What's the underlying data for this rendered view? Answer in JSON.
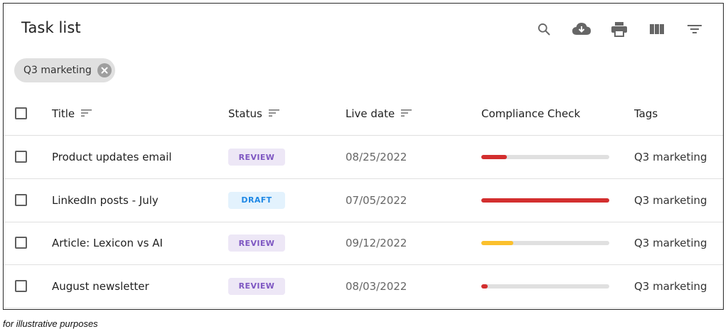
{
  "header": {
    "title": "Task list",
    "toolbar": [
      {
        "name": "search-icon"
      },
      {
        "name": "download-icon"
      },
      {
        "name": "print-icon"
      },
      {
        "name": "view-columns-icon"
      },
      {
        "name": "filter-icon"
      }
    ]
  },
  "filter_chip": {
    "label": "Q3 marketing",
    "icon": "close-circle-icon"
  },
  "table": {
    "columns": {
      "title": "Title",
      "status": "Status",
      "live_date": "Live date",
      "compliance": "Compliance Check",
      "tags": "Tags"
    },
    "rows": [
      {
        "title": "Product updates email",
        "status": "REVIEW",
        "live_date": "08/25/2022",
        "compliance": 0.2,
        "compliance_color": "#d32f2f",
        "tags": "Q3 marketing"
      },
      {
        "title": "LinkedIn posts - July",
        "status": "DRAFT",
        "live_date": "07/05/2022",
        "compliance": 1.0,
        "compliance_color": "#d32f2f",
        "tags": "Q3 marketing"
      },
      {
        "title": "Article: Lexicon vs AI",
        "status": "REVIEW",
        "live_date": "09/12/2022",
        "compliance": 0.25,
        "compliance_color": "#fbc02d",
        "tags": "Q3 marketing"
      },
      {
        "title": "August newsletter",
        "status": "REVIEW",
        "live_date": "08/03/2022",
        "compliance": 0.05,
        "compliance_color": "#d32f2f",
        "tags": "Q3 marketing"
      }
    ]
  },
  "colors": {
    "review_badge_bg": "#ede7f6",
    "review_badge_text": "#7e57c2",
    "draft_badge_bg": "#e3f2fd",
    "draft_badge_text": "#1e88e5",
    "track": "#e0e0e0"
  },
  "caption": "for illustrative purposes"
}
